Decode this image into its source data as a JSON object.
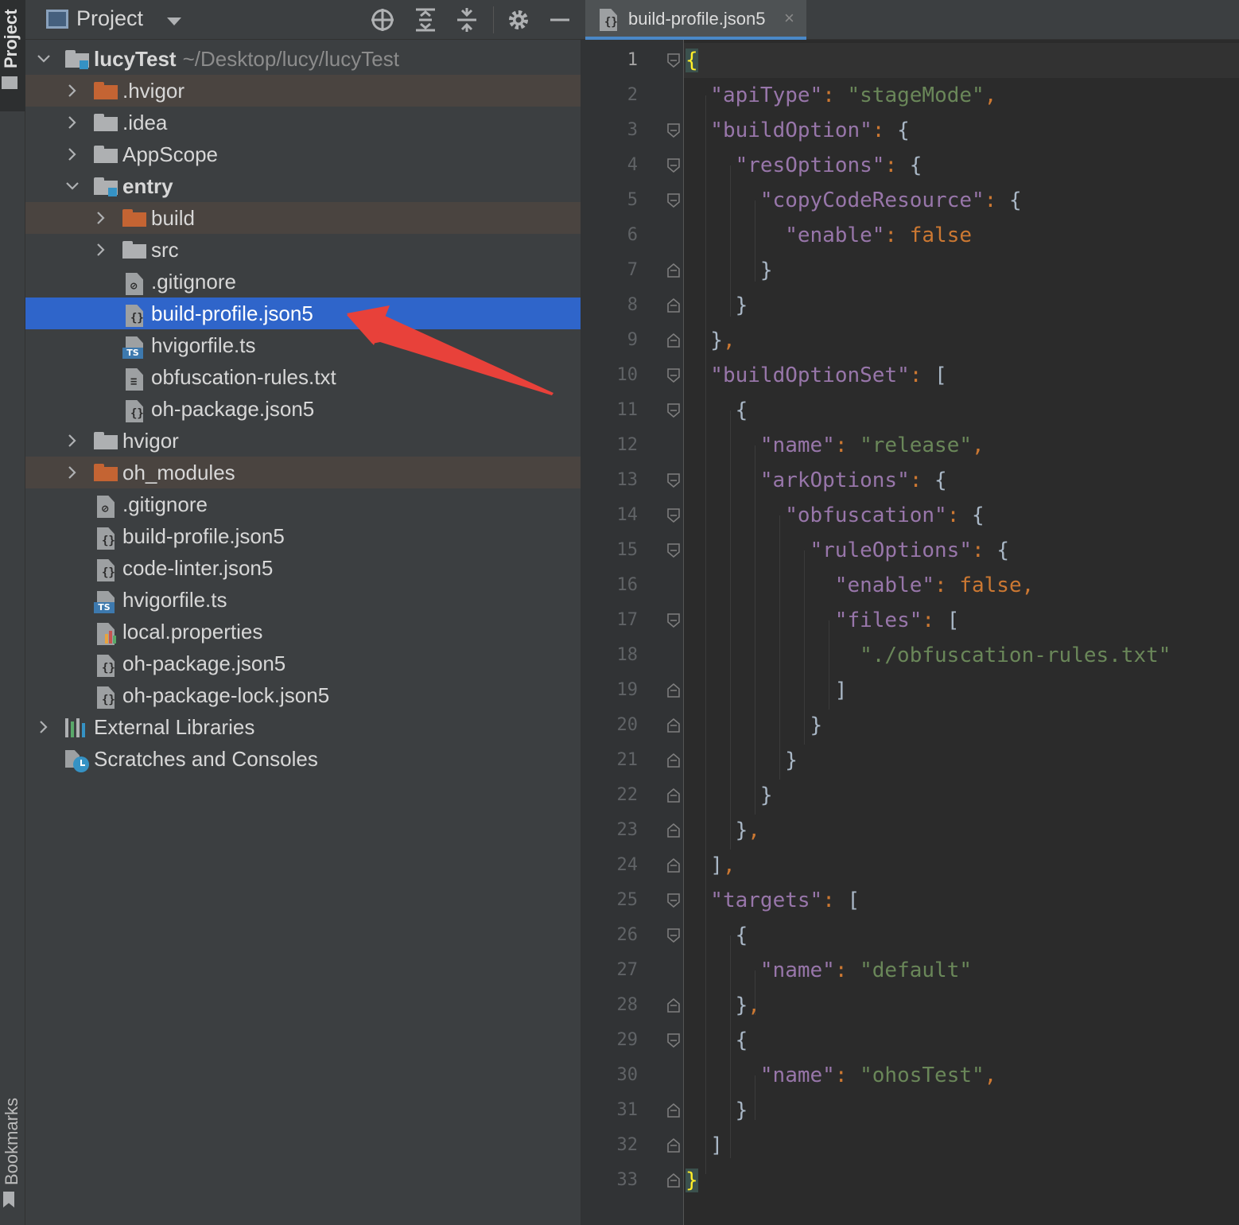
{
  "tool_strip": {
    "project_label": "Project",
    "bookmarks_label": "Bookmarks"
  },
  "project_panel": {
    "title": "Project",
    "root": {
      "name": "lucyTest",
      "path": "~/Desktop/lucy/lucyTest"
    },
    "items": [
      {
        "label": ".hvigor"
      },
      {
        "label": ".idea"
      },
      {
        "label": "AppScope"
      },
      {
        "label": "entry"
      },
      {
        "label": "build"
      },
      {
        "label": "src"
      },
      {
        "label": ".gitignore"
      },
      {
        "label": "build-profile.json5"
      },
      {
        "label": "hvigorfile.ts"
      },
      {
        "label": "obfuscation-rules.txt"
      },
      {
        "label": "oh-package.json5"
      },
      {
        "label": "hvigor"
      },
      {
        "label": "oh_modules"
      },
      {
        "label": ".gitignore"
      },
      {
        "label": "build-profile.json5"
      },
      {
        "label": "code-linter.json5"
      },
      {
        "label": "hvigorfile.ts"
      },
      {
        "label": "local.properties"
      },
      {
        "label": "oh-package.json5"
      },
      {
        "label": "oh-package-lock.json5"
      },
      {
        "label": "External Libraries"
      },
      {
        "label": "Scratches and Consoles"
      }
    ]
  },
  "editor": {
    "tab_label": "build-profile.json5",
    "tab_close": "×",
    "lines": [
      "1",
      "2",
      "3",
      "4",
      "5",
      "6",
      "7",
      "8",
      "9",
      "10",
      "11",
      "12",
      "13",
      "14",
      "15",
      "16",
      "17",
      "18",
      "19",
      "20",
      "21",
      "22",
      "23",
      "24",
      "25",
      "26",
      "27",
      "28",
      "29",
      "30",
      "31",
      "32",
      "33"
    ]
  },
  "colors": {
    "selection": "#2f65ca",
    "excluded_row": "#4a4440",
    "json_key": "#9876aa",
    "json_string": "#6a8759",
    "json_keyword": "#cc7832",
    "annotation_arrow": "#e8413a"
  }
}
